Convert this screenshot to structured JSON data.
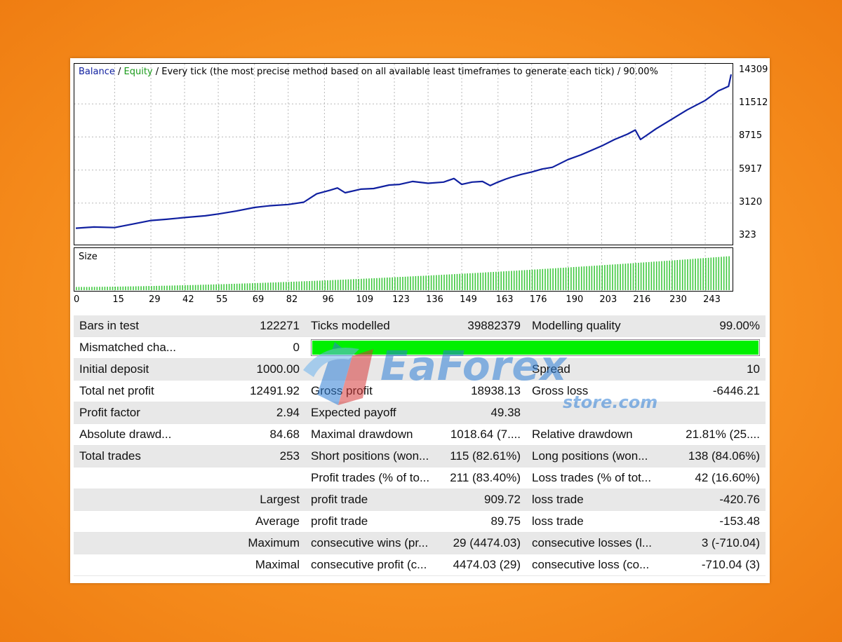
{
  "chart": {
    "legend": {
      "balance": "Balance",
      "sep1": " / ",
      "equity": "Equity",
      "rest": " / Every tick (the most precise method based on all available least timeframes to generate each tick) / 90.00%"
    },
    "size_label": "Size",
    "colors": {
      "balance": "#1020a0",
      "equity": "#1a9a1a",
      "size_bars": "#3ec83e",
      "grid": "#b8b8b8"
    }
  },
  "chart_data": [
    {
      "type": "line",
      "title": "",
      "y_ticks": [
        "14309",
        "11512",
        "8715",
        "5917",
        "3120",
        "323"
      ],
      "ylim": [
        323,
        14309
      ],
      "xlim": [
        0,
        253
      ],
      "grid": true,
      "series": [
        {
          "name": "Balance",
          "x": [
            0,
            7,
            15,
            22,
            29,
            35,
            42,
            50,
            55,
            62,
            69,
            75,
            82,
            88,
            93,
            98,
            101,
            104,
            110,
            115,
            118,
            121,
            125,
            130,
            136,
            142,
            146,
            149,
            153,
            157,
            160,
            163,
            166,
            168,
            172,
            176,
            180,
            184,
            190,
            195,
            203,
            208,
            213,
            216,
            218,
            220,
            224,
            230,
            236,
            243,
            248,
            250,
            252,
            253
          ],
          "y": [
            1000,
            1100,
            1050,
            1350,
            1650,
            1750,
            1900,
            2050,
            2200,
            2450,
            2750,
            2900,
            3000,
            3200,
            3900,
            4200,
            4400,
            4000,
            4300,
            4350,
            4500,
            4650,
            4700,
            4950,
            4800,
            4900,
            5200,
            4700,
            4900,
            4950,
            4600,
            4900,
            5150,
            5300,
            5550,
            5750,
            6000,
            6150,
            6800,
            7200,
            7950,
            8500,
            8950,
            9300,
            8500,
            8800,
            9400,
            10200,
            11000,
            11800,
            12600,
            12800,
            13000,
            14000
          ]
        }
      ]
    },
    {
      "type": "bar",
      "title": "",
      "x_ticks": [
        "0",
        "15",
        "29",
        "42",
        "55",
        "69",
        "82",
        "96",
        "109",
        "123",
        "136",
        "149",
        "163",
        "176",
        "190",
        "203",
        "216",
        "230",
        "243"
      ],
      "series": [
        {
          "name": "Size",
          "start": 0.08,
          "end": 0.85,
          "count": 253
        }
      ]
    }
  ],
  "stats": {
    "rows": [
      [
        "Bars in test",
        "122271",
        "Ticks modelled",
        "39882379",
        "Modelling quality",
        "99.00%"
      ],
      [
        "Mismatched cha...",
        "0",
        "",
        "",
        "",
        ""
      ],
      [
        "Initial deposit",
        "1000.00",
        "",
        "",
        "Spread",
        "10"
      ],
      [
        "Total net profit",
        "12491.92",
        "Gross profit",
        "18938.13",
        "Gross loss",
        "-6446.21"
      ],
      [
        "Profit factor",
        "2.94",
        "Expected payoff",
        "49.38",
        "",
        ""
      ],
      [
        "Absolute drawd...",
        "84.68",
        "Maximal drawdown",
        "1018.64 (7....",
        "Relative drawdown",
        "21.81% (25...."
      ],
      [
        "Total trades",
        "253",
        "Short positions (won...",
        "115 (82.61%)",
        "Long positions (won...",
        "138 (84.06%)"
      ],
      [
        "",
        "",
        "Profit trades (% of to...",
        "211 (83.40%)",
        "Loss trades (% of tot...",
        "42 (16.60%)"
      ],
      [
        "",
        "Largest",
        "profit trade",
        "909.72",
        "loss trade",
        "-420.76"
      ],
      [
        "",
        "Average",
        "profit trade",
        "89.75",
        "loss trade",
        "-153.48"
      ],
      [
        "",
        "Maximum",
        "consecutive wins (pr...",
        "29 (4474.03)",
        "consecutive losses (l...",
        "3 (-710.04)"
      ],
      [
        "",
        "Maximal",
        "consecutive profit (c...",
        "4474.03 (29)",
        "consecutive loss (co...",
        "-710.04 (3)"
      ]
    ],
    "mismatch_progress": 1.0
  },
  "watermark": {
    "title": "EaForex",
    "subtitle": "store.com"
  }
}
